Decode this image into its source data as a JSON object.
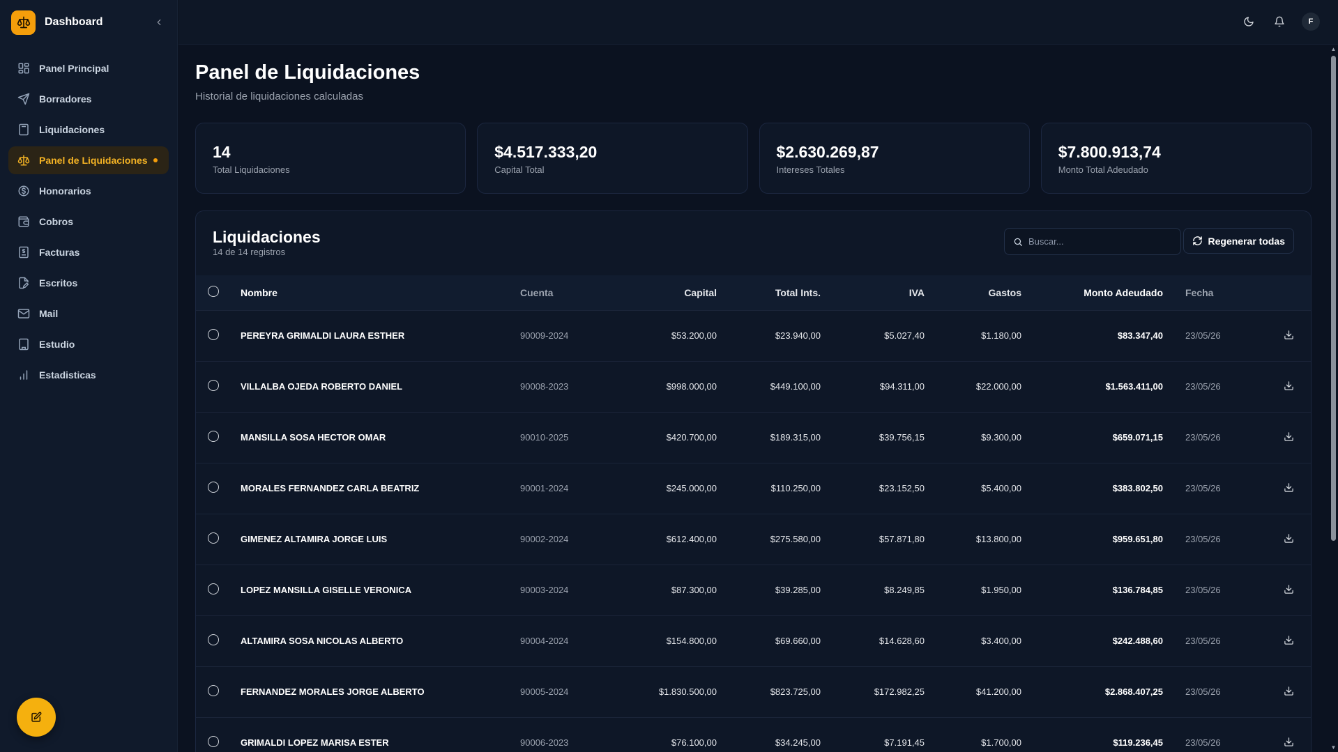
{
  "brand": {
    "title": "Dashboard"
  },
  "sidebar": {
    "items": [
      {
        "label": "Panel Principal",
        "icon": "grid-icon"
      },
      {
        "label": "Borradores",
        "icon": "send-icon"
      },
      {
        "label": "Liquidaciones",
        "icon": "calculator-icon"
      },
      {
        "label": "Panel de Liquidaciones",
        "icon": "scale-icon",
        "active": true
      },
      {
        "label": "Honorarios",
        "icon": "dollar-circle-icon"
      },
      {
        "label": "Cobros",
        "icon": "wallet-icon"
      },
      {
        "label": "Facturas",
        "icon": "invoice-icon"
      },
      {
        "label": "Escritos",
        "icon": "file-pen-icon"
      },
      {
        "label": "Mail",
        "icon": "mail-icon"
      },
      {
        "label": "Estudio",
        "icon": "building-icon"
      },
      {
        "label": "Estadisticas",
        "icon": "bar-chart-icon"
      }
    ]
  },
  "topbar": {
    "avatar_initial": "F"
  },
  "page": {
    "title": "Panel de Liquidaciones",
    "subtitle": "Historial de liquidaciones calculadas"
  },
  "stats": [
    {
      "value": "14",
      "label": "Total Liquidaciones"
    },
    {
      "value": "$4.517.333,20",
      "label": "Capital Total"
    },
    {
      "value": "$2.630.269,87",
      "label": "Intereses Totales"
    },
    {
      "value": "$7.800.913,74",
      "label": "Monto Total Adeudado"
    }
  ],
  "panel": {
    "title": "Liquidaciones",
    "subtitle": "14 de 14 registros",
    "search_placeholder": "Buscar...",
    "regen_label": "Regenerar todas"
  },
  "table": {
    "headers": [
      "Nombre",
      "Cuenta",
      "Capital",
      "Total Ints.",
      "IVA",
      "Gastos",
      "Monto Adeudado",
      "Fecha"
    ],
    "rows": [
      {
        "name": "PEREYRA GRIMALDI LAURA ESTHER",
        "account": "90009-2024",
        "capital": "$53.200,00",
        "interest": "$23.940,00",
        "iva": "$5.027,40",
        "expenses": "$1.180,00",
        "amount": "$83.347,40",
        "date": "23/05/26"
      },
      {
        "name": "VILLALBA OJEDA ROBERTO DANIEL",
        "account": "90008-2023",
        "capital": "$998.000,00",
        "interest": "$449.100,00",
        "iva": "$94.311,00",
        "expenses": "$22.000,00",
        "amount": "$1.563.411,00",
        "date": "23/05/26"
      },
      {
        "name": "MANSILLA SOSA HECTOR OMAR",
        "account": "90010-2025",
        "capital": "$420.700,00",
        "interest": "$189.315,00",
        "iva": "$39.756,15",
        "expenses": "$9.300,00",
        "amount": "$659.071,15",
        "date": "23/05/26"
      },
      {
        "name": "MORALES FERNANDEZ CARLA BEATRIZ",
        "account": "90001-2024",
        "capital": "$245.000,00",
        "interest": "$110.250,00",
        "iva": "$23.152,50",
        "expenses": "$5.400,00",
        "amount": "$383.802,50",
        "date": "23/05/26"
      },
      {
        "name": "GIMENEZ ALTAMIRA JORGE LUIS",
        "account": "90002-2024",
        "capital": "$612.400,00",
        "interest": "$275.580,00",
        "iva": "$57.871,80",
        "expenses": "$13.800,00",
        "amount": "$959.651,80",
        "date": "23/05/26"
      },
      {
        "name": "LOPEZ MANSILLA GISELLE VERONICA",
        "account": "90003-2024",
        "capital": "$87.300,00",
        "interest": "$39.285,00",
        "iva": "$8.249,85",
        "expenses": "$1.950,00",
        "amount": "$136.784,85",
        "date": "23/05/26"
      },
      {
        "name": "ALTAMIRA SOSA NICOLAS ALBERTO",
        "account": "90004-2024",
        "capital": "$154.800,00",
        "interest": "$69.660,00",
        "iva": "$14.628,60",
        "expenses": "$3.400,00",
        "amount": "$242.488,60",
        "date": "23/05/26"
      },
      {
        "name": "FERNANDEZ MORALES JORGE ALBERTO",
        "account": "90005-2024",
        "capital": "$1.830.500,00",
        "interest": "$823.725,00",
        "iva": "$172.982,25",
        "expenses": "$41.200,00",
        "amount": "$2.868.407,25",
        "date": "23/05/26"
      },
      {
        "name": "GRIMALDI LOPEZ MARISA ESTER",
        "account": "90006-2023",
        "capital": "$76.100,00",
        "interest": "$34.245,00",
        "iva": "$7.191,45",
        "expenses": "$1.700,00",
        "amount": "$119.236,45",
        "date": "23/05/26"
      }
    ]
  },
  "colors": {
    "accent": "#f59e0b",
    "background": "#0b1220",
    "surface": "#0e1727"
  }
}
